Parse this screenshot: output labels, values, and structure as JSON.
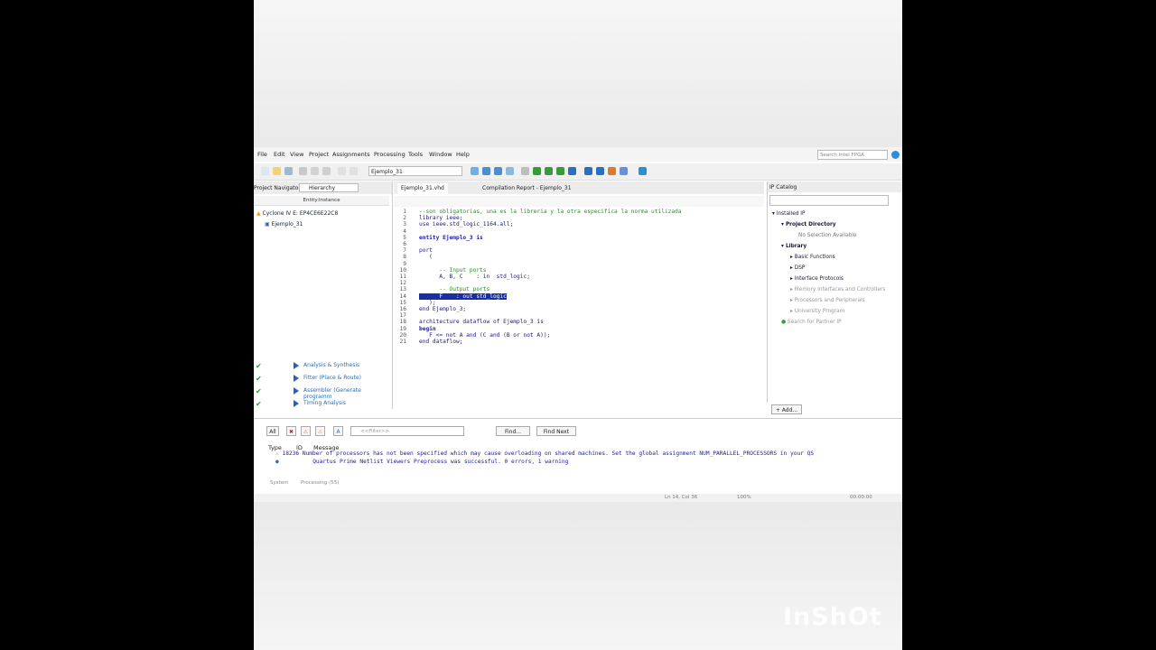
{
  "menu": [
    "File",
    "Edit",
    "View",
    "Project",
    "Assignments",
    "Processing",
    "Tools",
    "Window",
    "Help"
  ],
  "search": {
    "placeholder": "Search Intel FPGA"
  },
  "toolbar": {
    "project_combo": "Ejemplo_31"
  },
  "project_navigator": {
    "label": "Project Navigator",
    "view": "Hierarchy",
    "column": "Entity:Instance",
    "device": "Cyclone IV E: EP4CE6E22C8",
    "top": "Ejemplo_31"
  },
  "tasks": [
    {
      "label": "Analysis & Synthesis",
      "done": true
    },
    {
      "label": "Fitter (Place & Route)",
      "done": true
    },
    {
      "label": "Assembler (Generate programm",
      "done": true
    },
    {
      "label": "Timing Analysis",
      "done": true
    }
  ],
  "editor": {
    "tabs": [
      "Ejemplo_31.vhd",
      "Compilation Report - Ejemplo_31"
    ],
    "lines": [
      {
        "n": "1",
        "t": "--son obligatorias, una es la libreria y la otra especifica la norma utilizada",
        "c": "cmt"
      },
      {
        "n": "2",
        "t": "library ieee;",
        "c": ""
      },
      {
        "n": "3",
        "t": "use ieee.std_logic_1164.all;",
        "c": ""
      },
      {
        "n": "4",
        "t": "",
        "c": ""
      },
      {
        "n": "5",
        "t": "entity Ejemplo_3 is",
        "c": "kw"
      },
      {
        "n": "6",
        "t": "",
        "c": ""
      },
      {
        "n": "7",
        "t": "port",
        "c": ""
      },
      {
        "n": "8",
        "t": "   (",
        "c": ""
      },
      {
        "n": "9",
        "t": "",
        "c": ""
      },
      {
        "n": "10",
        "t": "      -- Input ports",
        "c": "cmt"
      },
      {
        "n": "11",
        "t": "      A, B, C    : in  std_logic;",
        "c": ""
      },
      {
        "n": "12",
        "t": "",
        "c": ""
      },
      {
        "n": "13",
        "t": "      -- Output ports",
        "c": "cmt"
      },
      {
        "n": "14",
        "t": "      F    : out std_logic",
        "c": "hl"
      },
      {
        "n": "15",
        "t": "   );",
        "c": ""
      },
      {
        "n": "16",
        "t": "end Ejemplo_3;",
        "c": ""
      },
      {
        "n": "17",
        "t": "",
        "c": ""
      },
      {
        "n": "18",
        "t": "architecture dataflow of Ejemplo_3 is",
        "c": ""
      },
      {
        "n": "19",
        "t": "begin",
        "c": "kw"
      },
      {
        "n": "20",
        "t": "   F <= not A and (C and (B or not A));",
        "c": ""
      },
      {
        "n": "21",
        "t": "end dataflow;",
        "c": ""
      }
    ]
  },
  "ip_catalog": {
    "title": "IP Catalog",
    "installed": "Installed IP",
    "project_directory": "Project Directory",
    "no_selection": "No Selection Available",
    "library": "Library",
    "items": [
      "Basic Functions",
      "DSP",
      "Interface Protocols",
      "Memory Interfaces and Controllers",
      "Processors and Peripherals",
      "University Program"
    ],
    "search_partner": "Search for Partner IP",
    "add": "+ Add..."
  },
  "messages": {
    "filters": [
      "All"
    ],
    "filter_placeholder": "<<Filter>>",
    "find": "Find...",
    "find_next": "Find Next",
    "headers": [
      "Type",
      "ID",
      "Message"
    ],
    "rows": [
      {
        "id": "18236",
        "text": "Number of processors has not been specified which may cause overloading on shared machines.  Set the global assignment NUM_PARALLEL_PROCESSORS in your QS"
      },
      {
        "id": "",
        "text": "Quartus Prime Netlist Viewers Preprocess was successful. 0 errors, 1 warning"
      }
    ],
    "tabs": [
      "System",
      "Processing (55)"
    ]
  },
  "status": {
    "position": "Ln 14, Col 36",
    "zoom": "100%",
    "time": "00:00:00"
  },
  "watermark": "InShOt",
  "colors": {
    "accent": "#2a8fd6",
    "highlight": "#1b2fa5",
    "ok": "#2aa22a"
  }
}
